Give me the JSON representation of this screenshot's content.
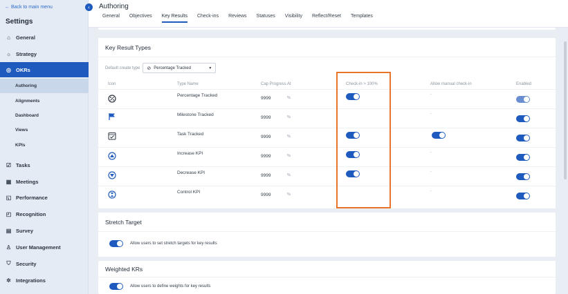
{
  "sidebar": {
    "back": "← Back to main menu",
    "title": "Settings",
    "items": [
      {
        "label": "General"
      },
      {
        "label": "Strategy"
      },
      {
        "label": "OKRs"
      },
      {
        "label": "Tasks"
      },
      {
        "label": "Meetings"
      },
      {
        "label": "Performance"
      },
      {
        "label": "Recognition"
      },
      {
        "label": "Survey"
      },
      {
        "label": "User Management"
      },
      {
        "label": "Security"
      },
      {
        "label": "Integrations"
      }
    ],
    "okr_sub": [
      {
        "label": "Authoring"
      },
      {
        "label": "Alignments"
      },
      {
        "label": "Dashboard"
      },
      {
        "label": "Views"
      },
      {
        "label": "KPIs"
      }
    ]
  },
  "header": {
    "title": "Authoring",
    "tabs": [
      "General",
      "Objectives",
      "Key Results",
      "Check-ins",
      "Reviews",
      "Statuses",
      "Visibility",
      "Reflect/Reset",
      "Templates"
    ],
    "active_tab": "Key Results"
  },
  "kr_types": {
    "title": "Key Result Types",
    "default_label": "Default create type",
    "default_value": "Percentage Tracked",
    "columns": [
      "Icon",
      "Type Name",
      "Cap Progress At",
      "Check-in > 100%",
      "Allow manual check-in",
      "Enabled"
    ],
    "rows": [
      {
        "name": "Percentage Tracked",
        "cap": "9999",
        "unit": "%",
        "checkin_over": true,
        "manual": "-",
        "enabled": true
      },
      {
        "name": "Milestone Tracked",
        "cap": "9999",
        "unit": "%",
        "checkin_over": false,
        "manual": "-",
        "enabled": true
      },
      {
        "name": "Task Tracked",
        "cap": "9999",
        "unit": "%",
        "checkin_over": true,
        "manual": "on",
        "enabled": true
      },
      {
        "name": "Increase KPI",
        "cap": "9999",
        "unit": "%",
        "checkin_over": true,
        "manual": "-",
        "enabled": true
      },
      {
        "name": "Decrease KPI",
        "cap": "9999",
        "unit": "%",
        "checkin_over": true,
        "manual": "-",
        "enabled": true
      },
      {
        "name": "Control KPI",
        "cap": "9999",
        "unit": "%",
        "checkin_over": false,
        "manual": "-",
        "enabled": true
      }
    ]
  },
  "stretch": {
    "title": "Stretch Target",
    "option": "Allow users to set stretch targets for key results"
  },
  "weighted": {
    "title": "Weighted KRs",
    "option": "Allow users to define weights for key results"
  },
  "colors": {
    "accent": "#1f5bbf",
    "highlight": "#e8742a"
  }
}
